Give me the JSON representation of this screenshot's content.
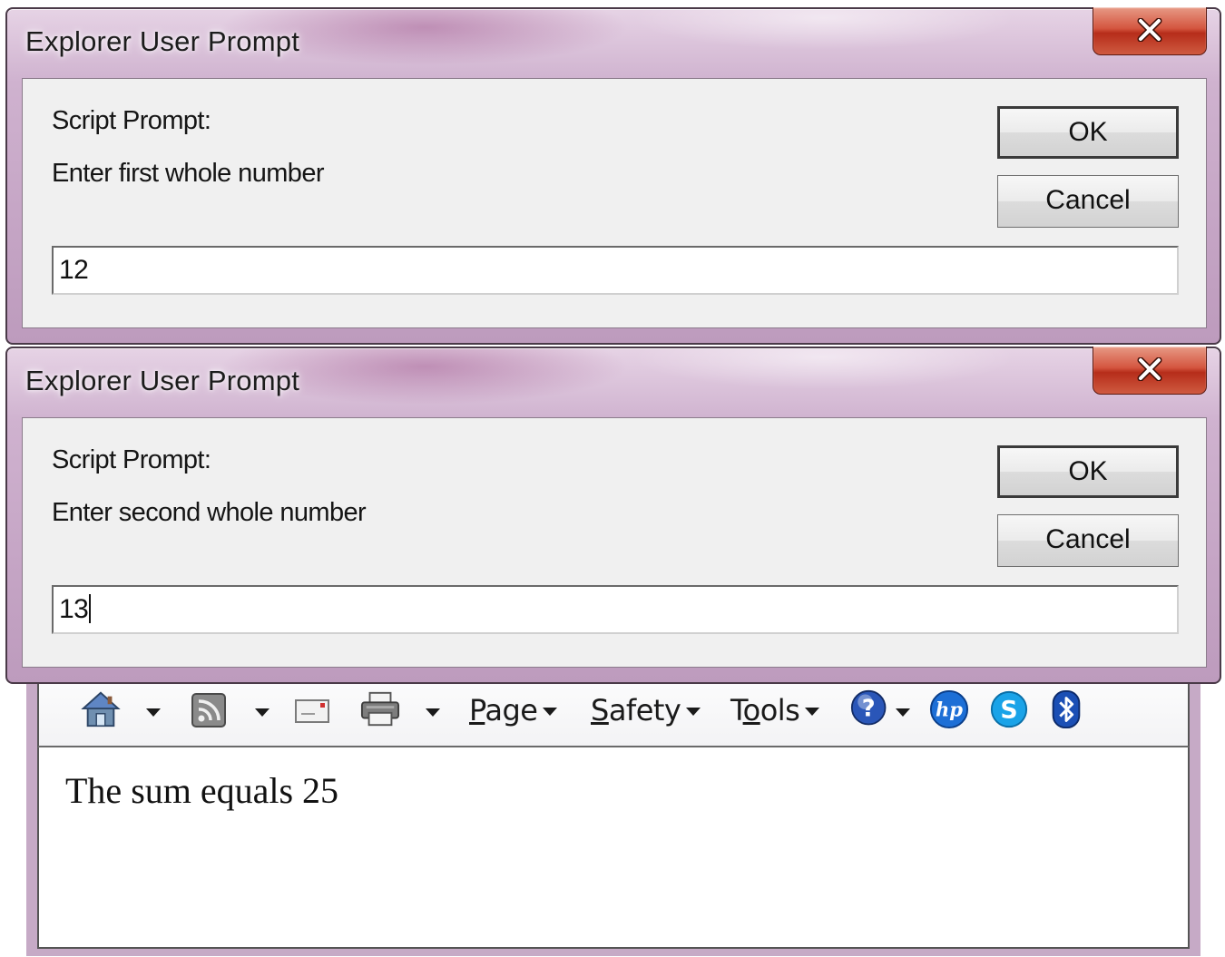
{
  "dialogs": [
    {
      "title": "Explorer User Prompt",
      "prompt_label": "Script Prompt:",
      "message": "Enter first whole number",
      "ok_label": "OK",
      "cancel_label": "Cancel",
      "input_value": "12"
    },
    {
      "title": "Explorer User Prompt",
      "prompt_label": "Script Prompt:",
      "message": "Enter second whole number",
      "ok_label": "OK",
      "cancel_label": "Cancel",
      "input_value": "13"
    }
  ],
  "browser": {
    "toolbar": {
      "icons": [
        "home-icon",
        "rss-feeds-icon",
        "read-mail-icon",
        "print-icon",
        "help-icon",
        "hp-icon",
        "skype-icon",
        "bluetooth-icon"
      ],
      "menus": {
        "page_first": "P",
        "page_rest": "age",
        "safety_first": "S",
        "safety_rest": "afety",
        "tools_pre": "T",
        "tools_mid": "o",
        "tools_rest": "ols"
      }
    },
    "output_text": "The sum equals 25"
  },
  "colors": {
    "frame": "#c6a6c6",
    "close_button": "#c8402a",
    "client_bg": "#f0f0f0"
  }
}
